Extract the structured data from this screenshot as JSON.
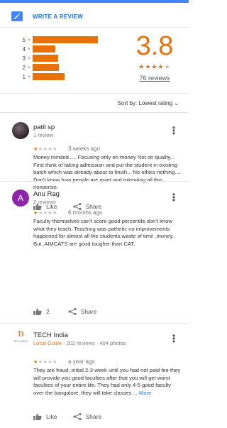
{
  "header": {
    "write_review_label": "WRITE A REVIEW"
  },
  "histogram": {
    "rows": [
      {
        "star": "5",
        "fraction": 0.57
      },
      {
        "star": "4",
        "fraction": 0.2
      },
      {
        "star": "3",
        "fraction": 0.22
      },
      {
        "star": "2",
        "fraction": 0.23
      },
      {
        "star": "1",
        "fraction": 0.28
      }
    ]
  },
  "summary": {
    "average": "3.8",
    "average_value": 3.8,
    "review_count": "76 reviews"
  },
  "sort": {
    "label": "Sort by:",
    "value": "Lowest rating"
  },
  "reviews": [
    {
      "name": "patil sp",
      "sub": "1 review",
      "rating": 1,
      "time": "3 weeks ago",
      "text": "Money minded..... Focusing only on money Not on quality... First think of taking admission and put the student in existing batch  which was already about to finish... No ethics nothing.... Don't know how people are quiet and tolerating all this nonsense.",
      "like_label": "Like",
      "like_count": "",
      "share_label": "Share"
    },
    {
      "name": "Anu Rag",
      "avatar_letter": "A",
      "sub": "2 reviews",
      "rating": 1,
      "time": "6 months ago",
      "text": "Faculty themselves can't score good percentile,don't know what they teach. Teaching was pathetic no improvements happened for almost all the students,waste of time ,money. But, AIMCATS are good tougher than CAT.",
      "like_label": "",
      "like_count": "2",
      "share_label": "Share"
    },
    {
      "name": "TECH India",
      "avatar_text": "TI",
      "avatar_caption": "TECH INDIA",
      "guide_label": "Local Guide",
      "sub": " · 202 reviews · 404 photos",
      "rating": 1,
      "time": "a year ago",
      "text": "They are fraud, initial 2-3 week until you had not paid fee they will provide you good faculties after that you will get worst faculties of your entire life. They had only 4-5 good faculty over the bangalore, they will take classes ...",
      "more_label": "More",
      "like_label": "Like",
      "like_count": "",
      "share_label": "Share"
    }
  ],
  "colors": {
    "accent": "#e8710a",
    "blue": "#4285f4",
    "link": "#1a73e8",
    "avatar_purple": "#8e24aa"
  }
}
